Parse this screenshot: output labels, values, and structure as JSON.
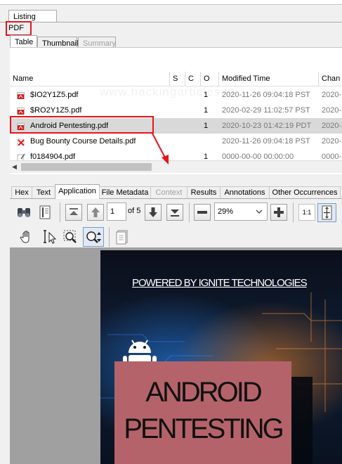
{
  "top_tabs": {
    "listing": "Listing",
    "pdf_label": "PDF"
  },
  "sub_tabs": {
    "table": "Table",
    "thumbnail": "Thumbnail",
    "summary": "Summary"
  },
  "table": {
    "headers": {
      "name": "Name",
      "s": "S",
      "c": "C",
      "o": "O",
      "modified": "Modified Time",
      "change": "Chan"
    },
    "rows": [
      {
        "name": "$IO2Y1Z5.pdf",
        "o": "1",
        "modified": "2020-11-26 09:04:18 PST",
        "change": "2020-"
      },
      {
        "name": "$RO2Y1Z5.pdf",
        "o": "1",
        "modified": "2020-02-29 11:02:57 PST",
        "change": "2020-"
      },
      {
        "name": "Android Pentesting.pdf",
        "o": "1",
        "modified": "2020-10-23 01:42:19 PDT",
        "change": "2020-"
      },
      {
        "name": "Bug Bounty Course Details.pdf",
        "o": "",
        "modified": "2020-11-26 09:04:18 PST",
        "change": "2020-"
      },
      {
        "name": "f0184904.pdf",
        "o": "1",
        "modified": "0000-00-00 00:00:00",
        "change": "0000-"
      }
    ],
    "watermark": "www.hackingarticles.in"
  },
  "lower_tabs": [
    "Hex",
    "Text",
    "Application",
    "File Metadata",
    "Context",
    "Results",
    "Annotations",
    "Other Occurrences"
  ],
  "pdf_toolbar": {
    "page_value": "1",
    "page_total": "of 5",
    "zoom_value": "29%",
    "zoom_actual_label": "1:1"
  },
  "slide": {
    "powered_by": "POWERED BY IGNITE TECHNOLOGIES",
    "title_line1": "ANDROID",
    "title_line2": "PENTESTING"
  },
  "colors": {
    "accent_red": "#e8141c",
    "selected_row": "#d9d9d9",
    "slide_box": "#b5636a"
  }
}
